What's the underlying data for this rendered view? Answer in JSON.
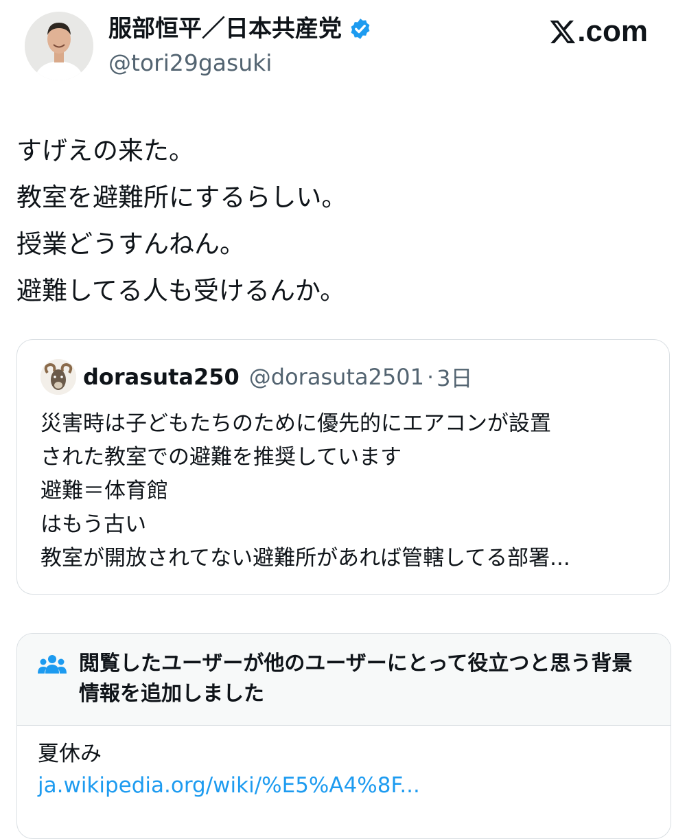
{
  "author": {
    "display_name": "服部恒平／日本共産党",
    "handle": "@tori29gasuki",
    "verified": true,
    "verified_color": "#1d9bf0"
  },
  "brand": {
    "logo_text": ".com",
    "logo_icon": "x-logo-icon"
  },
  "tweet": {
    "lines": [
      "すげえの来た。",
      "教室を避難所にするらしい。",
      "授業どうすんねん。",
      "避難してる人も受けるんか。"
    ]
  },
  "quoted_tweet": {
    "display_name": "dorasuta250",
    "handle": "@dorasuta2501",
    "separator": "·",
    "time": "3日",
    "lines": [
      "災害時は子どもたちのために優先的にエアコンが設置",
      "された教室での避難を推奨しています",
      "避難＝体育館",
      "はもう古い",
      "教室が開放されてない避難所があれば管轄してる部署..."
    ]
  },
  "community_note": {
    "icon": "people-icon",
    "title": "閲覧したユーザーが他のユーザーにとって役立つと思う背景情報を追加しました",
    "text": "夏休み",
    "link": "ja.wikipedia.org/wiki/%E5%A4%8F...",
    "link_color": "#1d9bf0"
  }
}
